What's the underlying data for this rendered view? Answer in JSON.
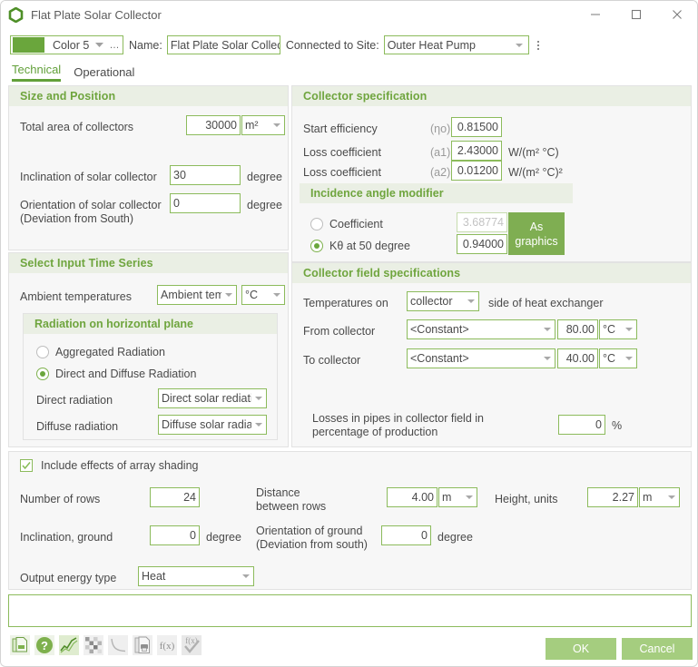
{
  "window": {
    "title": "Flat Plate Solar Collector",
    "icon": "hexagon-ring-icon",
    "minimize": "minimize-icon",
    "maximize": "maximize-icon",
    "close": "close-icon"
  },
  "header": {
    "color_value": "Color 5",
    "color_swatch_hex": "#6aa63c",
    "more_dots": "…",
    "name_label": "Name:",
    "name_value": "Flat Plate Solar Collector",
    "site_label": "Connected to Site:",
    "site_value": "Outer Heat Pump"
  },
  "tabs": [
    {
      "label": "Technical",
      "active": true
    },
    {
      "label": "Operational",
      "active": false
    }
  ],
  "size_and_position": {
    "title": "Size and Position",
    "total_area_label": "Total area of collectors",
    "total_area_value": "30000",
    "total_area_unit": "m²",
    "inclination_label": "Inclination of solar collector",
    "inclination_value": "30",
    "inclination_unit": "degree",
    "orientation_label_1": "Orientation of solar collector",
    "orientation_label_2": "(Deviation from South)",
    "orientation_value": "0",
    "orientation_unit": "degree"
  },
  "time_series": {
    "title": "Select Input Time Series",
    "ambient_label": "Ambient temperatures",
    "ambient_value": "Ambient temperature",
    "ambient_unit": "°C",
    "radiation": {
      "title": "Radiation on horizontal plane",
      "option_aggregated": "Aggregated Radiation",
      "option_direct_diffuse": "Direct and Diffuse Radiation",
      "selected": "direct_diffuse",
      "direct_label": "Direct radiation",
      "direct_value": "Direct solar rediation",
      "diffuse_label": "Diffuse radiation",
      "diffuse_value": "Diffuse solar radiation"
    }
  },
  "collector_specification": {
    "title": "Collector specification",
    "rows": [
      {
        "label": "Start efficiency",
        "symbol": "(ηo)",
        "value": "0.81500",
        "unit": ""
      },
      {
        "label": "Loss coefficient",
        "symbol": "(a1)",
        "value": "2.43000",
        "unit": "W/(m² °C)"
      },
      {
        "label": "Loss coefficient",
        "symbol": "(a2)",
        "value": "0.01200",
        "unit": "W/(m² °C)²"
      }
    ],
    "incidence": {
      "title": "Incidence angle modifier",
      "option_coefficient": "Coefficient",
      "coefficient_value": "3.68774",
      "option_ktheta": "Kθ at 50 degree",
      "ktheta_value": "0.94000",
      "selected": "ktheta",
      "graphics_button_line1": "As",
      "graphics_button_line2": "graphics"
    }
  },
  "collector_field": {
    "title": "Collector field specifications",
    "temps_on_label": "Temperatures on",
    "temps_on_value": "collector",
    "temps_on_suffix": "side of heat exchanger",
    "from_label": "From collector",
    "from_source": "<Constant>",
    "from_value": "80.00",
    "from_unit": "°C",
    "to_label": "To collector",
    "to_source": "<Constant>",
    "to_value": "40.00",
    "to_unit": "°C",
    "losses_label_1": "Losses in pipes in collector field in",
    "losses_label_2": "percentage of production",
    "losses_value": "0",
    "losses_unit": "%"
  },
  "array_shading": {
    "checkbox_label": "Include effects of array shading",
    "checked": true,
    "rows_label": "Number of rows",
    "rows_value": "24",
    "distance_label_1": "Distance",
    "distance_label_2": "between rows",
    "distance_value": "4.00",
    "distance_unit": "m",
    "height_label": "Height, units",
    "height_value": "2.27",
    "height_unit": "m",
    "inclination_ground_label": "Inclination, ground",
    "inclination_ground_value": "0",
    "inclination_ground_unit": "degree",
    "orientation_ground_label_1": "Orientation of ground",
    "orientation_ground_label_2": "(Deviation from south)",
    "orientation_ground_value": "0",
    "orientation_ground_unit": "degree",
    "output_energy_label": "Output energy type",
    "output_energy_value": "Heat"
  },
  "notes": {
    "value": ""
  },
  "toolbar": [
    {
      "name": "copy-document-icon",
      "enabled": true
    },
    {
      "name": "help-question-icon",
      "enabled": true
    },
    {
      "name": "chart-line-icon",
      "enabled": true
    },
    {
      "name": "heatmap-grid-icon",
      "enabled": true
    },
    {
      "name": "curve-decay-icon",
      "enabled": false
    },
    {
      "name": "print-document-icon",
      "enabled": false
    },
    {
      "name": "function-fx-icon",
      "enabled": false
    },
    {
      "name": "function-fx-check-icon",
      "enabled": false
    }
  ],
  "footer": {
    "ok_label": "OK",
    "cancel_label": "Cancel",
    "button_hex": "#a5cd7f"
  }
}
